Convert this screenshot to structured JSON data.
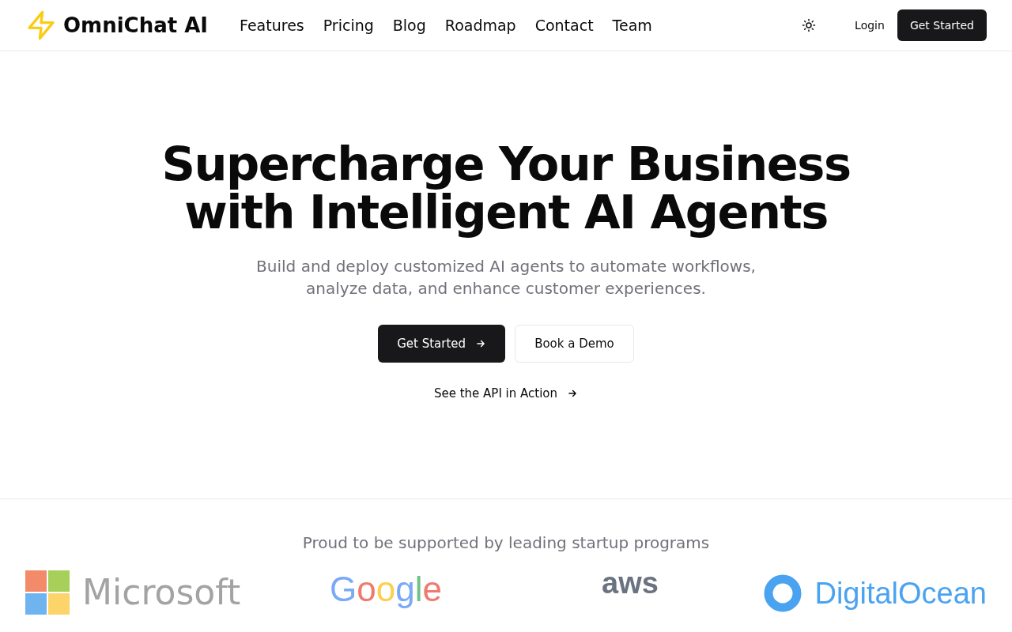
{
  "brand": {
    "name": "OmniChat AI"
  },
  "nav": [
    "Features",
    "Pricing",
    "Blog",
    "Roadmap",
    "Contact",
    "Team"
  ],
  "header_actions": {
    "login": "Login",
    "cta": "Get Started"
  },
  "hero": {
    "title_lines": [
      "Supercharge Your Business",
      "with Intelligent AI Agents"
    ],
    "subtitle": "Build and deploy customized AI agents to automate workflows, analyze data, and enhance customer experiences.",
    "primary_button": "Get Started",
    "secondary_button": "Book a Demo",
    "api_link": "See the API in Action"
  },
  "supporters": {
    "heading": "Proud to be supported by leading startup programs",
    "logos": [
      {
        "kind": "microsoft",
        "name": "Microsoft"
      },
      {
        "kind": "google",
        "name": "Google"
      },
      {
        "kind": "aws",
        "name": "aws"
      },
      {
        "kind": "digitalocean",
        "name": "DigitalOcean"
      }
    ]
  }
}
